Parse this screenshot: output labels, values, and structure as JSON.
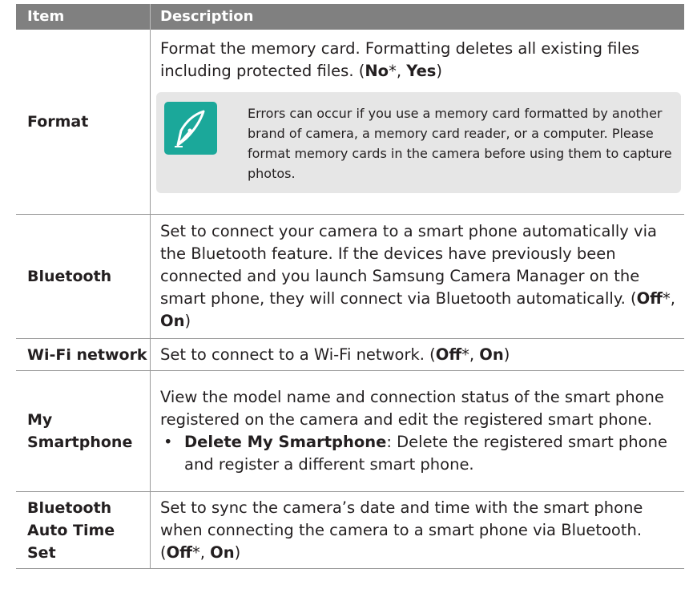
{
  "header": {
    "item": "Item",
    "description": "Description"
  },
  "rows": {
    "format": {
      "item": "Format",
      "desc_a": "Format the memory card. Formatting deletes all existing files including protected files. (",
      "opt1": "No",
      "star1": "*, ",
      "opt2": "Yes",
      "close": ")",
      "note": "Errors can occur if you use a memory card formatted by another brand of camera, a memory card reader, or a computer. Please format memory cards in the camera before using them to capture photos.",
      "note_icon": "pen-nib-icon"
    },
    "bluetooth": {
      "item": "Bluetooth",
      "desc_a": "Set to connect your camera to a smart phone automatically via the Bluetooth feature. If the devices have previously been connected and you launch Samsung Camera Manager on the smart phone, they will connect via Bluetooth automatically. (",
      "opt1": "Off",
      "star1": "*, ",
      "opt2": "On",
      "close": ")"
    },
    "wifi": {
      "item": "Wi-Fi network",
      "desc_a": "Set to connect to a Wi-Fi network. (",
      "opt1": "Off",
      "star1": "*, ",
      "opt2": "On",
      "close": ")"
    },
    "smartphone": {
      "item": "My Smartphone",
      "desc_a": "View the model name and connection status of the smart phone registered on the camera and edit the registered smart phone.",
      "bullet_mark": "•",
      "bullet_label": "Delete My Smartphone",
      "bullet_text": ": Delete the registered smart phone and register a different smart phone."
    },
    "timeset": {
      "item": "Bluetooth Auto Time Set",
      "desc_a": "Set to sync the camera’s date and time with the smart phone when connecting the camera to a smart phone via Bluetooth. (",
      "opt1": "Off",
      "star1": "*, ",
      "opt2": "On",
      "close": ")"
    }
  },
  "colors": {
    "header_bg": "#808080",
    "note_bg": "#e6e6e6",
    "icon_bg": "#1ba89a"
  }
}
